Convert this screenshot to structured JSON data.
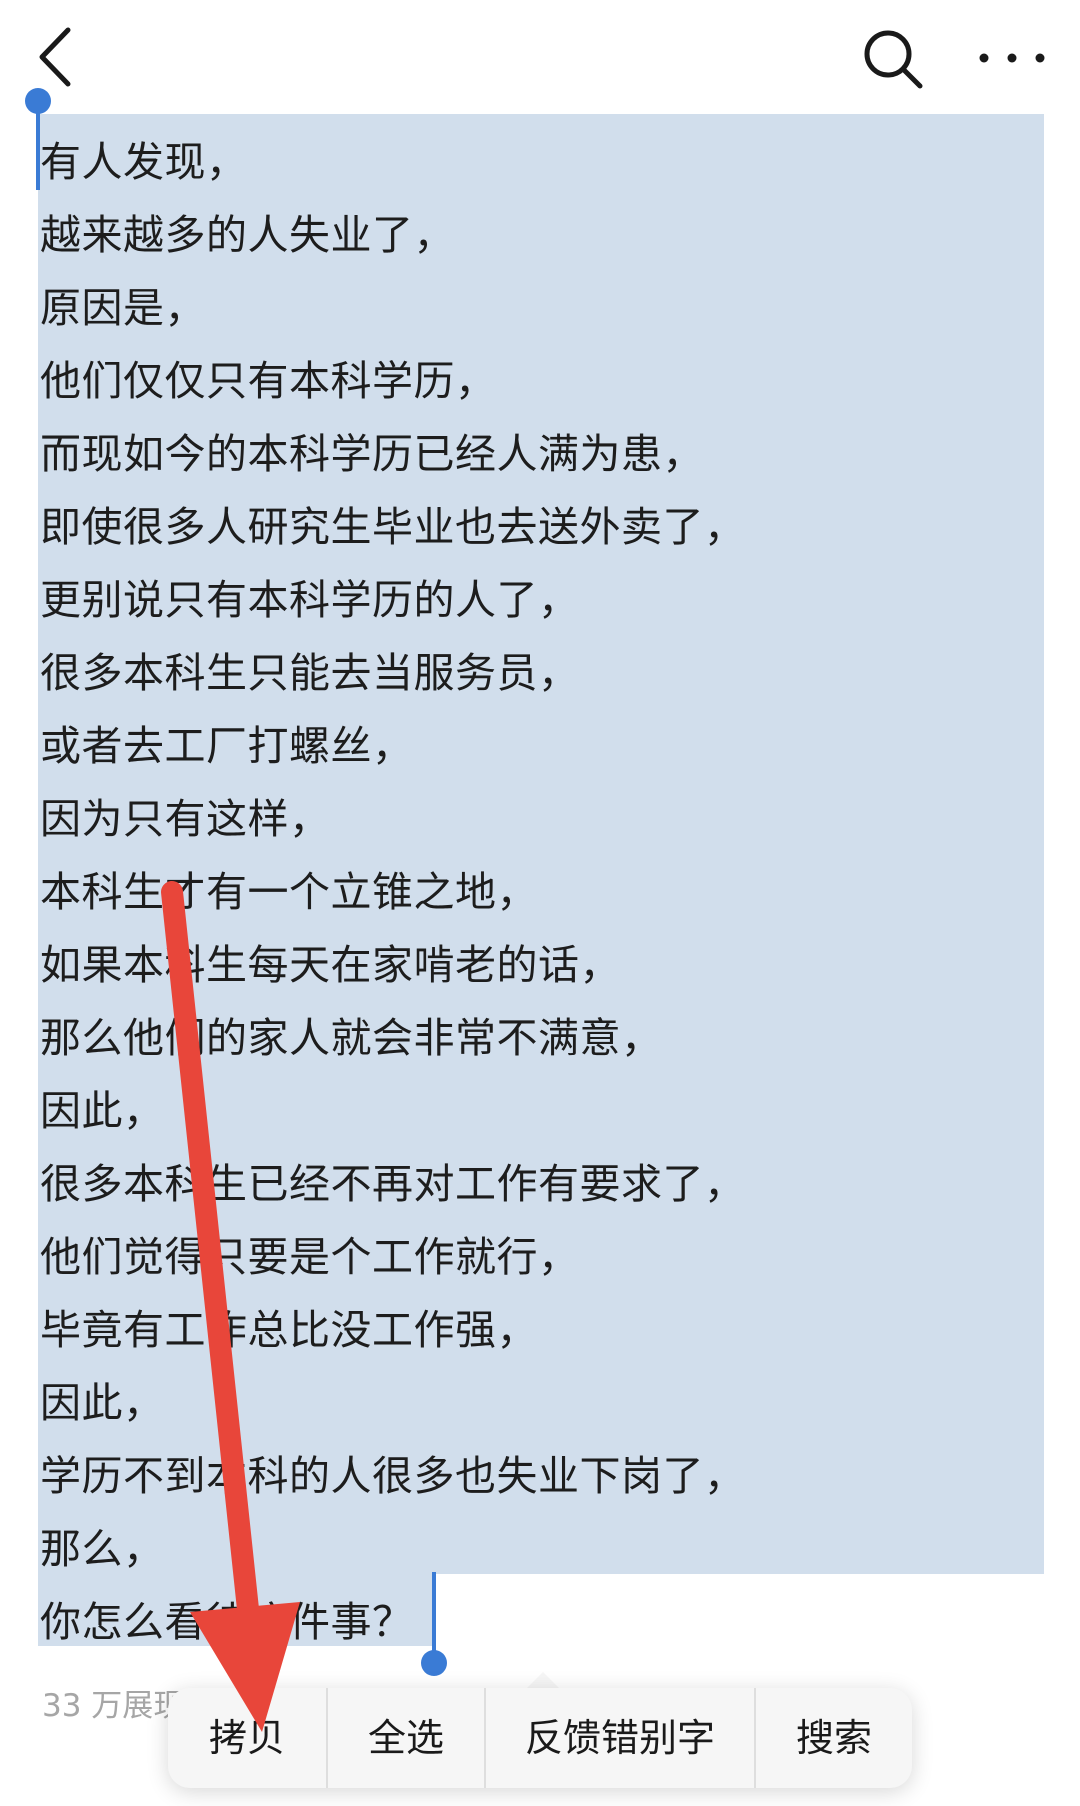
{
  "topbar": {
    "back_icon": "chevron-left-icon",
    "search_icon": "search-icon",
    "more_icon": "more-horizontal-icon"
  },
  "article": {
    "lines": [
      "有人发现，",
      "越来越多的人失业了，",
      "原因是，",
      "他们仅仅只有本科学历，",
      "而现如今的本科学历已经人满为患，",
      "即使很多人研究生毕业也去送外卖了，",
      "更别说只有本科学历的人了，",
      "很多本科生只能去当服务员，",
      "或者去工厂打螺丝，",
      "因为只有这样，",
      "本科生才有一个立锥之地，",
      "如果本科生每天在家啃老的话，",
      "那么他们的家人就会非常不满意，",
      "因此，",
      "很多本科生已经不再对工作有要求了，",
      "他们觉得只要是个工作就行，",
      "毕竟有工作总比没工作强，",
      "因此，",
      "学历不到本科的人很多也失业下岗了，",
      "那么，",
      "你怎么看待这件事？"
    ],
    "views": "33 万展现"
  },
  "context_menu": {
    "items": [
      "拷贝",
      "全选",
      "反馈错别字",
      "搜索"
    ]
  },
  "colors": {
    "selection": "#d1deec",
    "handle": "#3a7bd5",
    "arrow": "#e8463a"
  }
}
